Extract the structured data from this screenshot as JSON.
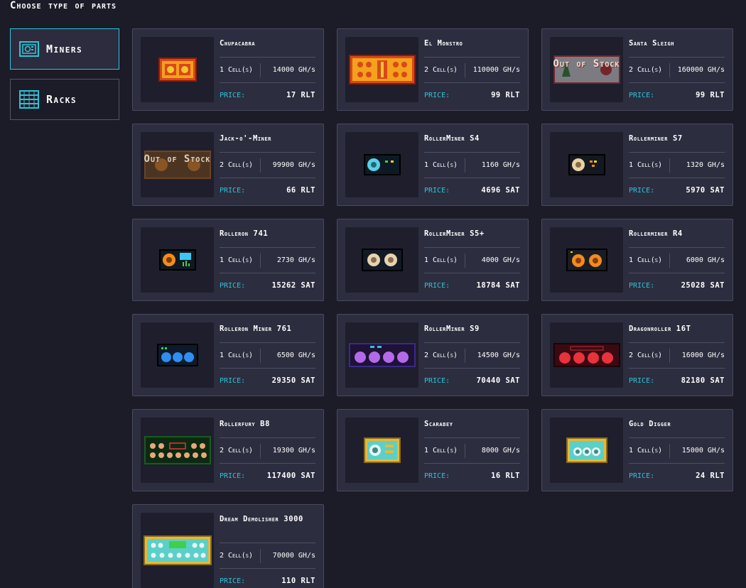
{
  "page": {
    "title": "Choose type of parts"
  },
  "tabs": [
    {
      "label": "Miners",
      "icon": "miner-icon",
      "active": true
    },
    {
      "label": "Racks",
      "icon": "rack-icon",
      "active": false
    }
  ],
  "colors": {
    "accent": "#2ec4d6",
    "card": "#2d2d40",
    "background": "#1c1b28"
  },
  "miners": [
    {
      "name": "Chupacabra",
      "cells": "1 Cell(s)",
      "power": "14000 GH/s",
      "price_label": "PRICE:",
      "price": "17 RLT",
      "out_of_stock": false,
      "icon": "chupacabra-miner-icon"
    },
    {
      "name": "El Monstro",
      "cells": "2 Cell(s)",
      "power": "110000 GH/s",
      "price_label": "PRICE:",
      "price": "99 RLT",
      "out_of_stock": false,
      "icon": "el-monstro-miner-icon"
    },
    {
      "name": "Santa Sleigh",
      "cells": "2 Cell(s)",
      "power": "160000 GH/s",
      "price_label": "PRICE:",
      "price": "99 RLT",
      "out_of_stock": true,
      "oos_text": "Out of Stock",
      "icon": "santa-sleigh-miner-icon"
    },
    {
      "name": "Jack-o'-Miner",
      "cells": "2 Cell(s)",
      "power": "99900 GH/s",
      "price_label": "PRICE:",
      "price": "66 RLT",
      "out_of_stock": true,
      "oos_text": "Out of Stock",
      "icon": "jack-o-miner-icon"
    },
    {
      "name": "RollerMiner S4",
      "cells": "1 Cell(s)",
      "power": "1160 GH/s",
      "price_label": "PRICE:",
      "price": "4696 SAT",
      "out_of_stock": false,
      "icon": "rollerminer-s4-icon"
    },
    {
      "name": "Rollerminer S7",
      "cells": "1 Cell(s)",
      "power": "1320 GH/s",
      "price_label": "PRICE:",
      "price": "5970 SAT",
      "out_of_stock": false,
      "icon": "rollerminer-s7-icon"
    },
    {
      "name": "Rolleron 741",
      "cells": "1 Cell(s)",
      "power": "2730 GH/s",
      "price_label": "PRICE:",
      "price": "15262 SAT",
      "out_of_stock": false,
      "icon": "rolleron-741-icon"
    },
    {
      "name": "RollerMiner S5+",
      "cells": "1 Cell(s)",
      "power": "4000 GH/s",
      "price_label": "PRICE:",
      "price": "18784 SAT",
      "out_of_stock": false,
      "icon": "rollerminer-s5-plus-icon"
    },
    {
      "name": "Rollerminer R4",
      "cells": "1 Cell(s)",
      "power": "6000 GH/s",
      "price_label": "PRICE:",
      "price": "25028 SAT",
      "out_of_stock": false,
      "icon": "rollerminer-r4-icon"
    },
    {
      "name": "Rolleron Miner 761",
      "cells": "1 Cell(s)",
      "power": "6500 GH/s",
      "price_label": "PRICE:",
      "price": "29350 SAT",
      "out_of_stock": false,
      "icon": "rolleron-miner-761-icon"
    },
    {
      "name": "RollerMiner S9",
      "cells": "2 Cell(s)",
      "power": "14500 GH/s",
      "price_label": "PRICE:",
      "price": "70440 SAT",
      "out_of_stock": false,
      "icon": "rollerminer-s9-icon"
    },
    {
      "name": "Dragonroller 16T",
      "cells": "2 Cell(s)",
      "power": "16000 GH/s",
      "price_label": "PRICE:",
      "price": "82180 SAT",
      "out_of_stock": false,
      "icon": "dragonroller-16t-icon"
    },
    {
      "name": "Rollerfury B8",
      "cells": "2 Cell(s)",
      "power": "19300 GH/s",
      "price_label": "PRICE:",
      "price": "117400 SAT",
      "out_of_stock": false,
      "icon": "rollerfury-b8-icon"
    },
    {
      "name": "Scarabey",
      "cells": "1 Cell(s)",
      "power": "8000 GH/s",
      "price_label": "PRICE:",
      "price": "16 RLT",
      "out_of_stock": false,
      "icon": "scarabey-icon"
    },
    {
      "name": "Gold Digger",
      "cells": "1 Cell(s)",
      "power": "15000 GH/s",
      "price_label": "PRICE:",
      "price": "24 RLT",
      "out_of_stock": false,
      "icon": "gold-digger-icon"
    },
    {
      "name": "Dream Demolisher 3000",
      "cells": "2 Cell(s)",
      "power": "70000 GH/s",
      "price_label": "PRICE:",
      "price": "110 RLT",
      "out_of_stock": false,
      "icon": "dream-demolisher-3000-icon"
    }
  ]
}
